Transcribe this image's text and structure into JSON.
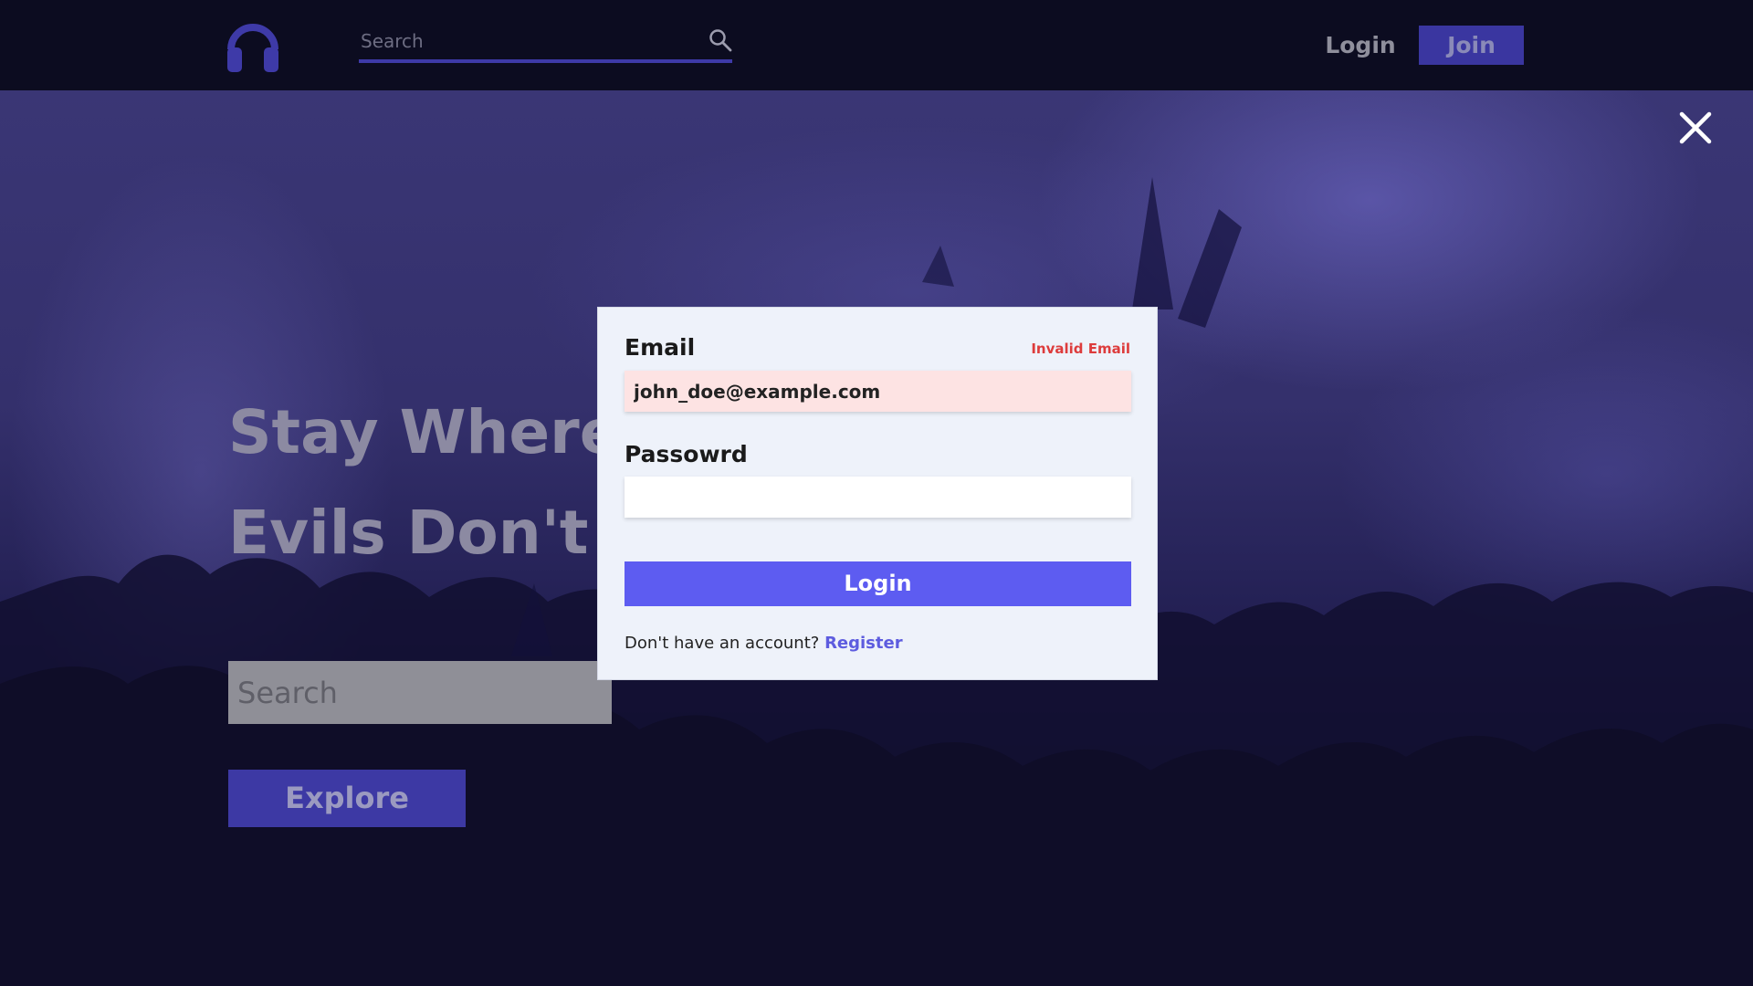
{
  "navbar": {
    "logo_icon": "headphones-icon",
    "search": {
      "placeholder": "Search",
      "value": "",
      "icon": "search-icon"
    },
    "login_label": "Login",
    "join_label": "Join"
  },
  "hero": {
    "title_line1": "Stay Where",
    "title_line2": "Evils Don't",
    "title_accent_partial": "S",
    "search_placeholder": "Search",
    "explore_label": "Explore"
  },
  "overlay": {
    "close_icon": "close-icon"
  },
  "login_modal": {
    "email_label": "Email",
    "email_error": "Invalid Email",
    "email_value": "john_doe@example.com",
    "password_label": "Passowrd",
    "password_value": "",
    "submit_label": "Login",
    "register_prompt": "Don't have an account?",
    "register_link": "Register"
  },
  "colors": {
    "navbar_bg": "#0c0c20",
    "accent": "#5d5cf1",
    "accent_dark": "#3a36a0",
    "error": "#dd3c3c",
    "modal_bg": "#eef2fa",
    "email_error_bg": "#fde3e3"
  }
}
